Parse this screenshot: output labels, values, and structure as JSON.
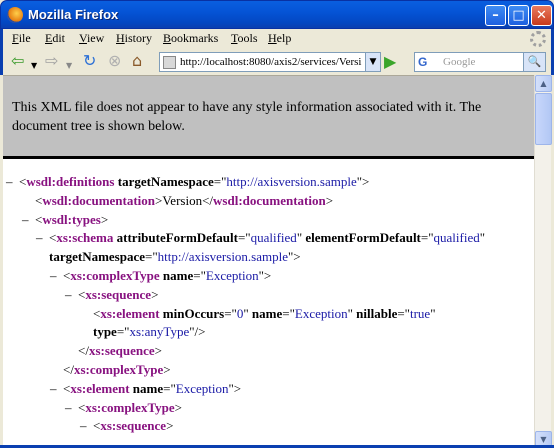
{
  "window": {
    "title": "Mozilla Firefox",
    "min_glyph": "–",
    "max_glyph": "□",
    "close_glyph": "✕"
  },
  "menu": {
    "items": [
      {
        "label": "File",
        "key": "F",
        "rest": "ile"
      },
      {
        "label": "Edit",
        "key": "E",
        "rest": "dit"
      },
      {
        "label": "View",
        "key": "V",
        "rest": "iew"
      },
      {
        "label": "History",
        "key": "H",
        "rest": "istory"
      },
      {
        "label": "Bookmarks",
        "key": "B",
        "rest": "ookmarks"
      },
      {
        "label": "Tools",
        "key": "T",
        "rest": "ools"
      },
      {
        "label": "Help",
        "key": "H",
        "rest": "elp"
      }
    ]
  },
  "nav": {
    "url": "http://localhost:8080/axis2/services/Versi",
    "search_placeholder": "Google",
    "search_engine_glyph": "G",
    "go_glyph": "▶",
    "dropdown_glyph": "▼",
    "search_button_glyph": "🔍",
    "back_glyph": "⇦",
    "forward_glyph": "⇨",
    "reload_glyph": "↻",
    "stop_glyph": "⊗",
    "home_glyph": "⌂",
    "icons": {
      "back": "back-arrow-icon",
      "forward": "forward-arrow-icon",
      "reload": "reload-icon",
      "stop": "stop-icon",
      "home": "home-icon"
    }
  },
  "info_message": "This XML file does not appear to have any style information associated with it. The document tree is shown below.",
  "xml": {
    "minus": "–",
    "l1": {
      "open": "<",
      "tag": "wsdl:definitions",
      "attr": "targetNamespace",
      "eq": "=\"",
      "val": "http://axisversion.sample",
      "close": "\">"
    },
    "l2": {
      "open": "<",
      "tag": "wsdl:documentation",
      "mid": ">Version</",
      "tag2": "wsdl:documentation",
      "close": ">"
    },
    "l3": {
      "open": "<",
      "tag": "wsdl:types",
      "close": ">"
    },
    "l4": {
      "open": "<",
      "tag": "xs:schema",
      "attr1": "attributeFormDefault",
      "eq1": "=\"",
      "val1": "qualified",
      "q1": "\"",
      "attr2": "elementFormDefault",
      "eq2": "=\"",
      "val2": "qualified",
      "q2": "\""
    },
    "l5": {
      "attr": "targetNamespace",
      "eq": "=\"",
      "val": "http://axisversion.sample",
      "close": "\">"
    },
    "l6": {
      "open": "<",
      "tag": "xs:complexType",
      "attr": "name",
      "eq": "=\"",
      "val": "Exception",
      "close": "\">"
    },
    "l7": {
      "open": "<",
      "tag": "xs:sequence",
      "close": ">"
    },
    "l8": {
      "open": "<",
      "tag": "xs:element",
      "attr1": "minOccurs",
      "eq1": "=\"",
      "val1": "0",
      "q1": "\"",
      "attr2": "name",
      "eq2": "=\"",
      "val2": "Exception",
      "q2": "\"",
      "attr3": "nillable",
      "eq3": "=\"",
      "val3": "true",
      "q3": "\""
    },
    "l9": {
      "attr": "type",
      "eq": "=\"",
      "val": "xs:anyType",
      "close": "\"/>"
    },
    "l10": {
      "open": "</",
      "tag": "xs:sequence",
      "close": ">"
    },
    "l11": {
      "open": "</",
      "tag": "xs:complexType",
      "close": ">"
    },
    "l12": {
      "open": "<",
      "tag": "xs:element",
      "attr": "name",
      "eq": "=\"",
      "val": "Exception",
      "close": "\">"
    },
    "l13": {
      "open": "<",
      "tag": "xs:complexType",
      "close": ">"
    },
    "l14": {
      "open": "<",
      "tag": "xs:sequence",
      "close": ">"
    }
  },
  "scrollbar": {
    "up_glyph": "▲",
    "down_glyph": "▼"
  }
}
